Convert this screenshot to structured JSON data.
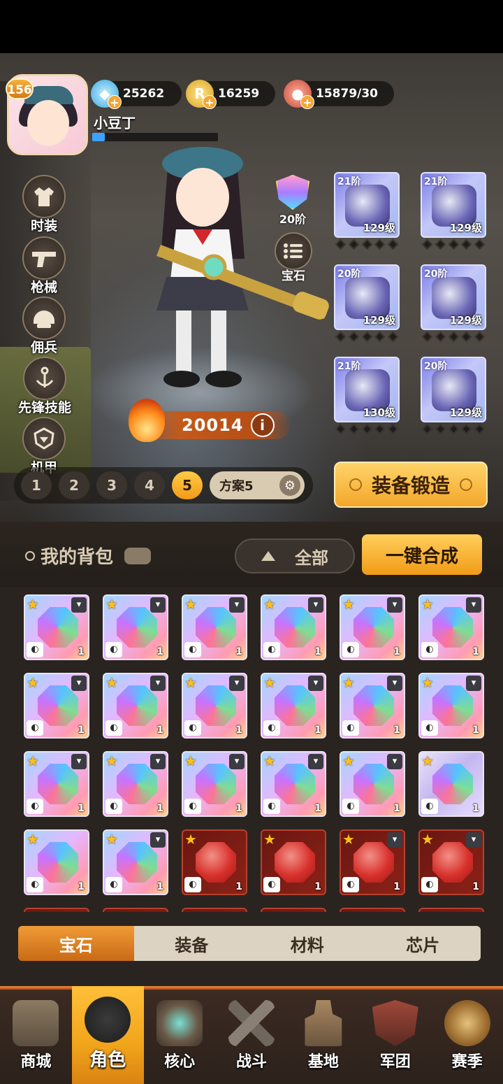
{
  "player": {
    "level": "156",
    "name": "小豆丁",
    "exp_fraction": 0.1
  },
  "resources": {
    "diamonds": "25262",
    "coins": "16259",
    "stamina": "15879/30",
    "coin_glyph": "R"
  },
  "side_menu": [
    "时装",
    "枪械",
    "佣兵",
    "先锋技能",
    "机甲"
  ],
  "character_panel": {
    "rank_label": "20阶",
    "gem_label": "宝石",
    "power": "20014",
    "info_glyph": "i"
  },
  "equipment": [
    {
      "tier": "21阶",
      "level": "129级"
    },
    {
      "tier": "21阶",
      "level": "129级"
    },
    {
      "tier": "20阶",
      "level": "129级"
    },
    {
      "tier": "20阶",
      "level": "129级"
    },
    {
      "tier": "21阶",
      "level": "130级"
    },
    {
      "tier": "20阶",
      "level": "129级"
    }
  ],
  "schemes": {
    "numbers": [
      "1",
      "2",
      "3",
      "4",
      "5"
    ],
    "active": "5",
    "name": "方案5"
  },
  "forge_button": "装备锻造",
  "bag": {
    "title": "我的背包",
    "filter": "全部",
    "merge_button": "一键合成",
    "items": [
      {
        "style": "rainbow",
        "lock": true,
        "qty": "1"
      },
      {
        "style": "rainbow",
        "lock": true,
        "qty": "1"
      },
      {
        "style": "rainbow",
        "lock": true,
        "qty": "1"
      },
      {
        "style": "rainbow",
        "lock": true,
        "qty": "1"
      },
      {
        "style": "rainbow",
        "lock": true,
        "qty": "1"
      },
      {
        "style": "rainbow",
        "lock": true,
        "qty": "1"
      },
      {
        "style": "rainbow",
        "lock": true,
        "qty": "1"
      },
      {
        "style": "rainbow",
        "lock": true,
        "qty": "1"
      },
      {
        "style": "rainbow",
        "lock": true,
        "qty": "1"
      },
      {
        "style": "rainbow",
        "lock": true,
        "qty": "1"
      },
      {
        "style": "rainbow",
        "lock": true,
        "qty": "1"
      },
      {
        "style": "rainbow",
        "lock": true,
        "qty": "1"
      },
      {
        "style": "rainbow",
        "lock": true,
        "qty": "1"
      },
      {
        "style": "rainbow",
        "lock": true,
        "qty": "1"
      },
      {
        "style": "rainbow",
        "lock": true,
        "qty": "1"
      },
      {
        "style": "rainbow",
        "lock": true,
        "qty": "1"
      },
      {
        "style": "rainbow",
        "lock": true,
        "qty": "1"
      },
      {
        "style": "lavender",
        "lock": false,
        "qty": "1"
      },
      {
        "style": "rainbow",
        "lock": false,
        "qty": "1"
      },
      {
        "style": "rainbow",
        "lock": true,
        "qty": "1"
      },
      {
        "style": "red",
        "lock": false,
        "qty": "1"
      },
      {
        "style": "red",
        "lock": false,
        "qty": "1"
      },
      {
        "style": "red",
        "lock": true,
        "qty": "1"
      },
      {
        "style": "red",
        "lock": true,
        "qty": "1"
      }
    ]
  },
  "bag_tabs": [
    "宝石",
    "装备",
    "材料",
    "芯片"
  ],
  "active_bag_tab": "宝石",
  "bottom_nav": [
    "商城",
    "角色",
    "核心",
    "战斗",
    "基地",
    "军团",
    "赛季"
  ],
  "active_nav": "角色",
  "colors": {
    "accent_orange": "#f19b17",
    "bag_background": "#2a2420",
    "exp_blue": "#3da2ff"
  }
}
